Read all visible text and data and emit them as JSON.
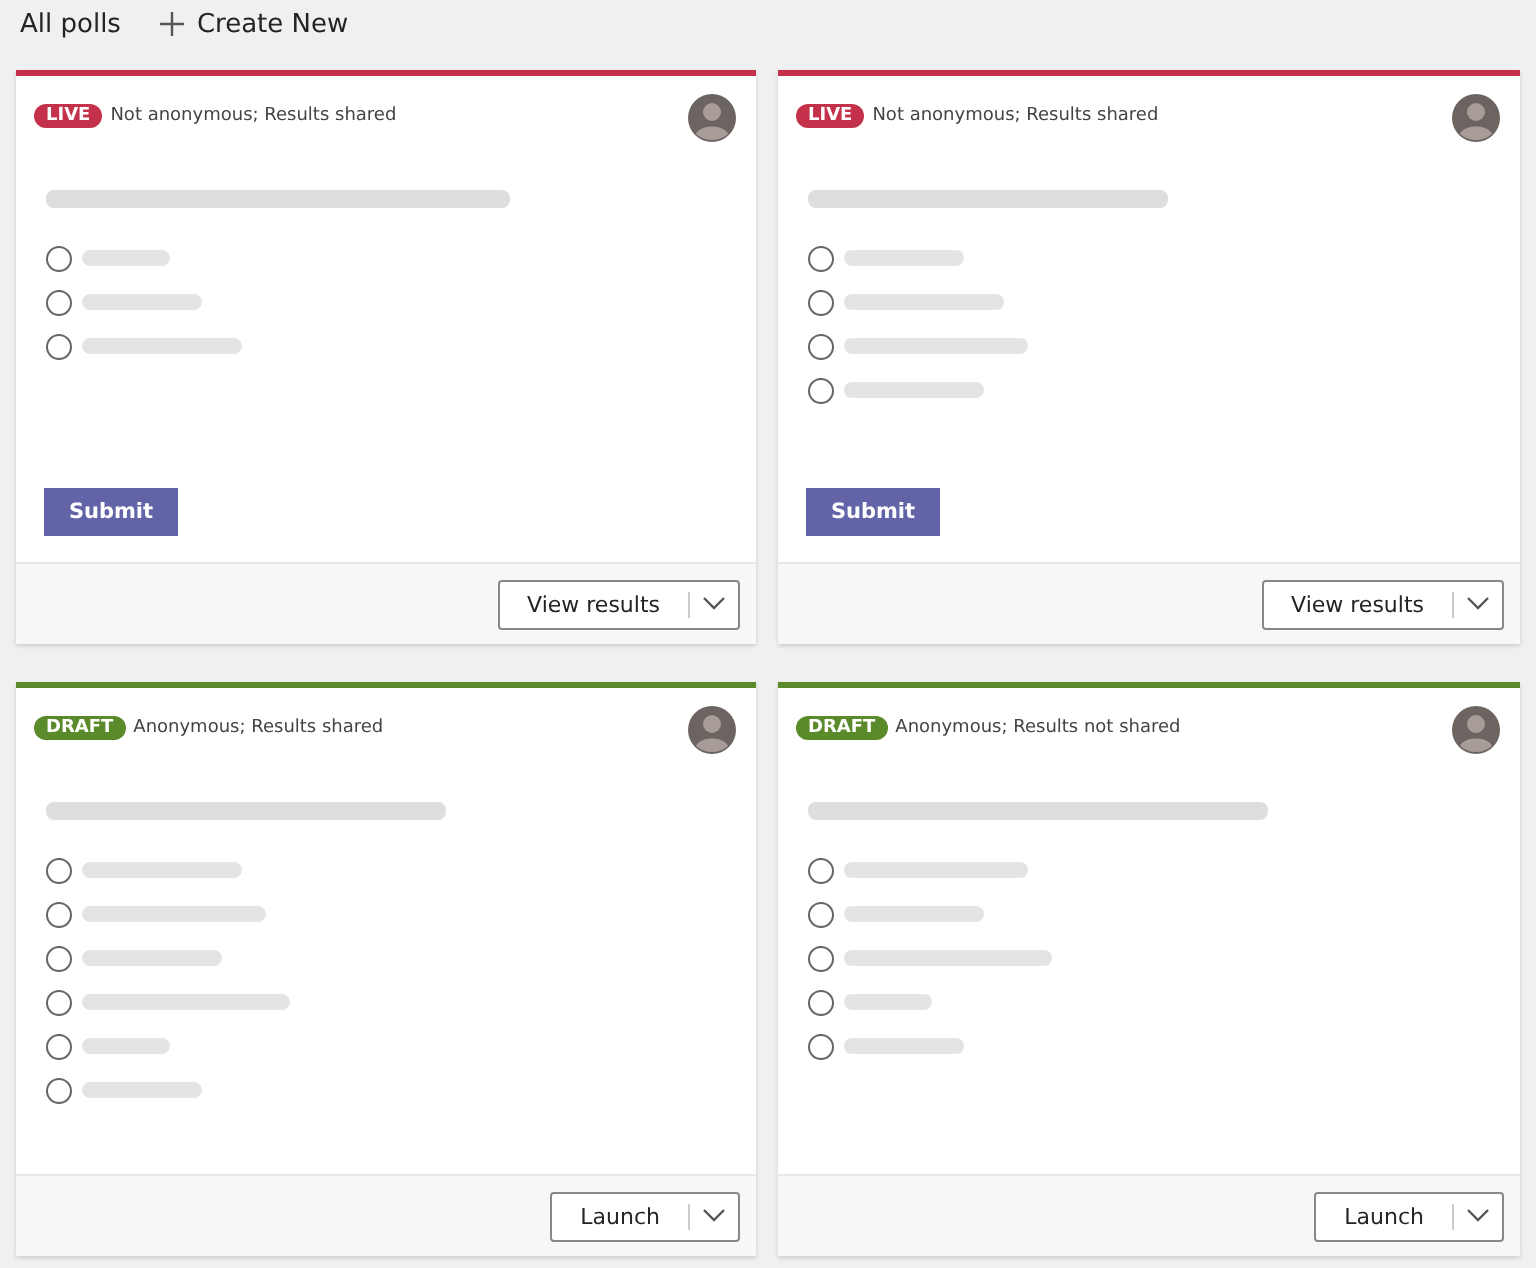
{
  "header": {
    "title": "All polls",
    "create_label": "Create New"
  },
  "polls": [
    {
      "status": "LIVE",
      "color": "#c4314b",
      "privacy": "Not anonymous; Results shared",
      "options": [
        {
          "selected": false
        },
        {
          "selected": false
        },
        {
          "selected": false
        }
      ],
      "submit_label": "Submit",
      "action_label": "View results"
    },
    {
      "status": "LIVE",
      "color": "#c4314b",
      "privacy": "Not anonymous; Results shared",
      "options": [
        {
          "selected": false
        },
        {
          "selected": false
        },
        {
          "selected": false
        },
        {
          "selected": false
        }
      ],
      "submit_label": "Submit",
      "action_label": "View results"
    },
    {
      "status": "DRAFT",
      "color": "#5b8a2a",
      "privacy": "Anonymous; Results shared",
      "options": [
        {
          "selected": false
        },
        {
          "selected": false
        },
        {
          "selected": false
        },
        {
          "selected": false
        },
        {
          "selected": false
        },
        {
          "selected": false
        }
      ],
      "action_label": "Launch"
    },
    {
      "status": "DRAFT",
      "color": "#5b8a2a",
      "privacy": "Anonymous; Results not shared",
      "options": [
        {
          "selected": false
        },
        {
          "selected": false
        },
        {
          "selected": false
        },
        {
          "selected": false
        },
        {
          "selected": false
        }
      ],
      "action_label": "Launch"
    }
  ]
}
